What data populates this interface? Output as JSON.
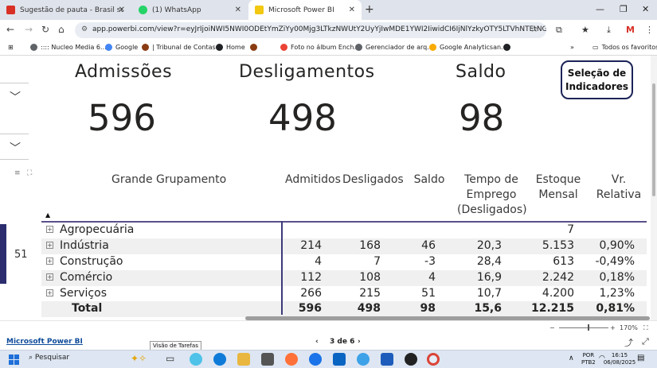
{
  "browser": {
    "tabs": [
      {
        "label": "Sugestão de pauta - Brasil supe",
        "icon": "gmail-icon",
        "color": "#d93025"
      },
      {
        "label": "(1) WhatsApp",
        "icon": "whatsapp-icon",
        "color": "#25d366"
      },
      {
        "label": "Microsoft Power BI",
        "icon": "powerbi-icon",
        "color": "#f2c811"
      }
    ],
    "url": "app.powerbi.com/view?r=eyJrIjoiNWI5NWI0ODEtYmZiYy00Mjg3LTkzNWUtY2UyYjIwMDE1YWI2IiwidCI6IjNlYzkyOTY5LTVhNTEtNGYxOC04YWM5...",
    "bookmarks": [
      {
        "label": ":::: Nucleo Media 6....",
        "color": "#5f6368"
      },
      {
        "label": "Google",
        "color": "#4285f4"
      },
      {
        "label": "| Tribunal de Contas...",
        "color": "#8a3b12"
      },
      {
        "label": "Home",
        "color": "#202124"
      },
      {
        "label": "",
        "color": "#8a3b12"
      },
      {
        "label": "Foto no álbum Ench...",
        "color": "#ea4335"
      },
      {
        "label": "Gerenciador de arq...",
        "color": "#5f6368"
      },
      {
        "label": "Google Analyticsan...",
        "color": "#f9ab00"
      },
      {
        "label": "",
        "color": "#202124"
      }
    ],
    "all_bookmarks_label": "Todos os favoritos"
  },
  "report": {
    "kpis": [
      {
        "label": "Admissões",
        "value": "596"
      },
      {
        "label": "Desligamentos",
        "value": "498"
      },
      {
        "label": "Saldo",
        "value": "98"
      }
    ],
    "selection_button": "Seleção de Indicadores",
    "side_number": "51",
    "table": {
      "columns": [
        "Grande Grupamento",
        "Admitidos",
        "Desligados",
        "Saldo",
        "Tempo de Emprego (Desligados)",
        "Estoque Mensal",
        "Vr. Relativa"
      ],
      "rows": [
        {
          "name": "Agropecuária",
          "admitidos": "",
          "desligados": "",
          "saldo": "",
          "tempo": "",
          "estoque": "7",
          "vr": ""
        },
        {
          "name": "Indústria",
          "admitidos": "214",
          "desligados": "168",
          "saldo": "46",
          "tempo": "20,3",
          "estoque": "5.153",
          "vr": "0,90%"
        },
        {
          "name": "Construção",
          "admitidos": "4",
          "desligados": "7",
          "saldo": "-3",
          "tempo": "28,4",
          "estoque": "613",
          "vr": "-0,49%"
        },
        {
          "name": "Comércio",
          "admitidos": "112",
          "desligados": "108",
          "saldo": "4",
          "tempo": "16,9",
          "estoque": "2.242",
          "vr": "0,18%"
        },
        {
          "name": "Serviços",
          "admitidos": "266",
          "desligados": "215",
          "saldo": "51",
          "tempo": "10,7",
          "estoque": "4.200",
          "vr": "1,23%"
        }
      ],
      "total": {
        "name": "Total",
        "admitidos": "596",
        "desligados": "498",
        "saldo": "98",
        "tempo": "15,6",
        "estoque": "12.215",
        "vr": "0,81%"
      }
    }
  },
  "footer": {
    "powerbi_link": "Microsoft Power BI",
    "pager": "3 de 6",
    "tooltip": "Visão de Tarefas",
    "zoom": "170%"
  },
  "taskbar": {
    "search": "Pesquisar",
    "lang": "POR",
    "layout": "PTB2",
    "time": "16:15",
    "date": "06/08/2025"
  }
}
